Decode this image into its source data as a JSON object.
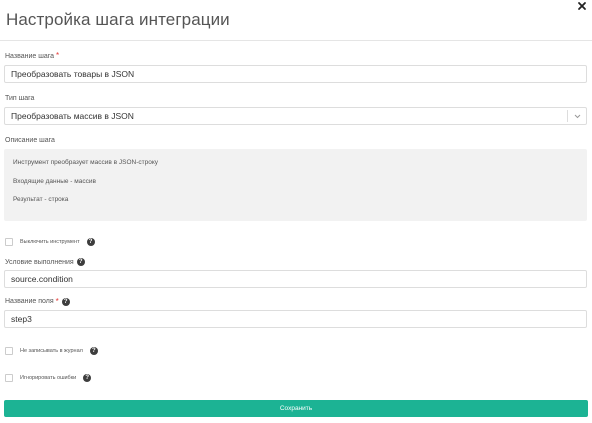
{
  "dialog": {
    "title": "Настройка шага интеграции",
    "close_icon": "close-icon"
  },
  "form": {
    "step_name": {
      "label": "Название шага",
      "required_mark": "*",
      "value": "Преобразовать товары в JSON"
    },
    "step_type": {
      "label": "Тип шага",
      "selected": "Преобразовать массив в JSON"
    },
    "description": {
      "label": "Описание шага",
      "lines": [
        "Инструмент преобразует массив в JSON-строку",
        "Входящие данные - массив",
        "Результат - строка"
      ]
    },
    "disable_tool": {
      "label": "Выключить инструмент",
      "checked": false,
      "help": "?"
    },
    "condition": {
      "label": "Условие выполнения",
      "help": "?",
      "value": "source.condition"
    },
    "field_name": {
      "label": "Название поля",
      "required_mark": "*",
      "help": "?",
      "value": "step3"
    },
    "no_log": {
      "label": "Не записывать в журнал",
      "checked": false,
      "help": "?"
    },
    "ignore_errors": {
      "label": "Игнорировать ошибки",
      "checked": false,
      "help": "?"
    },
    "save_button": "Сохранить"
  },
  "colors": {
    "accent": "#1cb394",
    "required": "#e53935",
    "description_bg": "#f2f2f2"
  }
}
